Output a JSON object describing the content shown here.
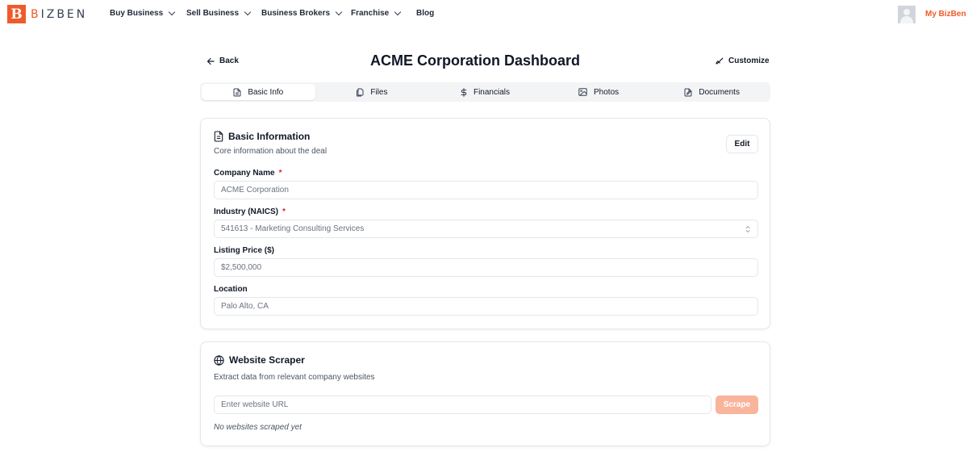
{
  "brand": {
    "mark": "B",
    "name_first": "B",
    "name_rest": "IZBEN"
  },
  "nav": {
    "items": [
      {
        "label": "Buy Business",
        "has_dropdown": true
      },
      {
        "label": "Sell Business",
        "has_dropdown": true
      },
      {
        "label": "Business Brokers",
        "has_dropdown": true
      },
      {
        "label": "Franchise",
        "has_dropdown": true
      },
      {
        "label": "Blog",
        "has_dropdown": false
      }
    ],
    "account_label": "My BizBen"
  },
  "header": {
    "back_label": "Back",
    "title": "ACME Corporation Dashboard",
    "customize_label": "Customize"
  },
  "tabs": [
    {
      "label": "Basic Info",
      "icon": "file-text-icon",
      "active": true
    },
    {
      "label": "Files",
      "icon": "files-icon",
      "active": false
    },
    {
      "label": "Financials",
      "icon": "dollar-icon",
      "active": false
    },
    {
      "label": "Photos",
      "icon": "image-icon",
      "active": false
    },
    {
      "label": "Documents",
      "icon": "document-edit-icon",
      "active": false
    }
  ],
  "basic_info": {
    "title": "Basic Information",
    "description": "Core information about the deal",
    "edit_label": "Edit",
    "fields": [
      {
        "label": "Company Name",
        "required": "*",
        "value": "ACME Corporation"
      },
      {
        "label": "Industry (NAICS)",
        "required": "*",
        "value": "541613 - Marketing Consulting Services"
      },
      {
        "label": "Listing Price ($)",
        "value": "$2,500,000"
      },
      {
        "label": "Location",
        "value": "Palo Alto, CA"
      }
    ]
  },
  "scraper": {
    "title": "Website Scraper",
    "description": "Extract data from relevant company websites",
    "url_placeholder": "Enter website URL",
    "scrape_label": "Scrape",
    "empty_note": "No websites scraped yet"
  },
  "colors": {
    "brand": "#ef5b2a",
    "scrape_button": "#f9b49c",
    "required": "#dc2626"
  }
}
